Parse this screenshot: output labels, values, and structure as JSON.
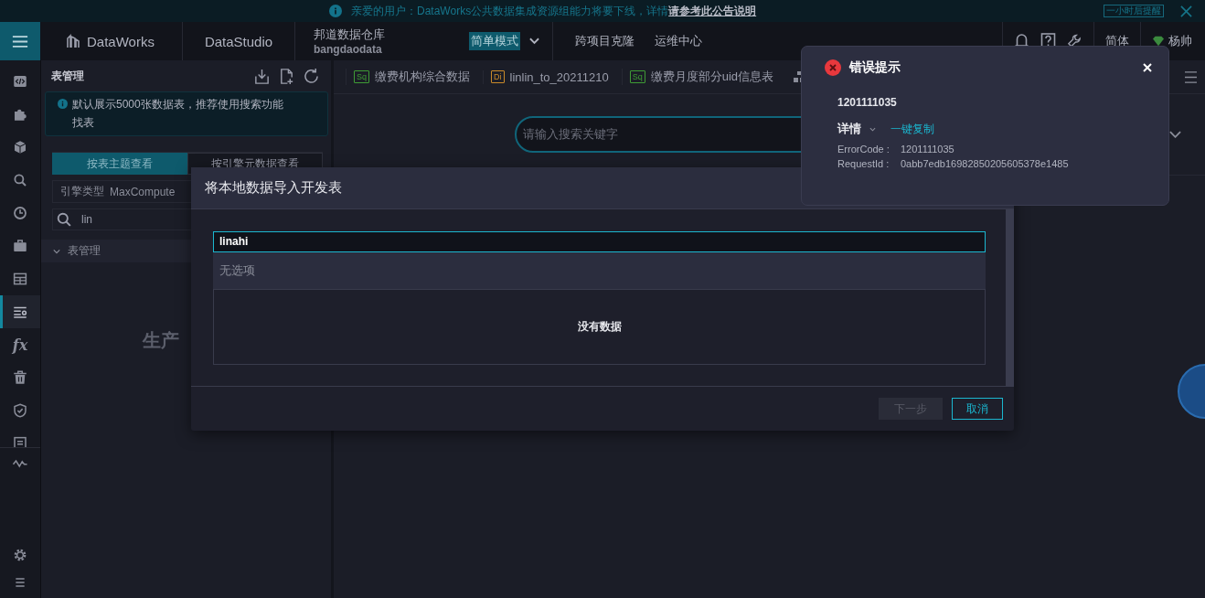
{
  "banner": {
    "message": "亲爱的用户：DataWorks公共数据集成资源组能力将要下线，详情",
    "link": "请参考此公告说明",
    "remind_button": "一小时后提醒"
  },
  "header": {
    "brand": "DataWorks",
    "module": "DataStudio",
    "workspace": {
      "name": "邦道数据仓库",
      "id": "bangdaodata"
    },
    "mode": "简单模式",
    "nav": [
      "跨项目克隆",
      "运维中心"
    ],
    "language": "简体",
    "user": "杨帅"
  },
  "rail": [
    {
      "selected": false
    },
    {
      "selected": false
    },
    {
      "selected": false
    },
    {
      "selected": false
    },
    {
      "selected": false
    },
    {
      "selected": false
    },
    {
      "selected": false
    },
    {
      "selected": true
    },
    {
      "selected": false,
      "glyph": "fx"
    },
    {
      "selected": false
    },
    {
      "selected": false
    },
    {
      "selected": false
    }
  ],
  "panel": {
    "title": "表管理",
    "notice": "默认展示5000张数据表，推荐使用搜索功能找表",
    "view_tabs": [
      {
        "label": "按表主题查看",
        "selected": true
      },
      {
        "label": "按引擎元数据查看",
        "selected": false
      }
    ],
    "engine": {
      "label": "引擎类型",
      "value": "MaxCompute"
    },
    "search": {
      "value": "lin"
    },
    "tree": [
      {
        "label": "表管理",
        "expanded": true
      }
    ],
    "background_text": "生产"
  },
  "editor_tabs": [
    {
      "label": "缴费机构综合数据",
      "type": "Sq",
      "color": "#3f9c35"
    },
    {
      "label": "linlin_to_20211210",
      "type": "Di",
      "color": "#c98a2a"
    },
    {
      "label": "缴费月度部分uid信息表",
      "type": "Sq",
      "color": "#3f9c35"
    }
  ],
  "search": {
    "placeholder": "请输入搜索关键字"
  },
  "dialog": {
    "title": "将本地数据导入开发表",
    "table_select": {
      "value": "linahi",
      "no_options": "无选项"
    },
    "empty": "没有数据",
    "buttons": [
      {
        "label": "下一步",
        "disabled": true
      },
      {
        "label": "取消",
        "disabled": false
      }
    ]
  },
  "toast": {
    "title": "错误提示",
    "message": "1201111035",
    "details_label": "详情",
    "copy_link": "一键复制",
    "fields": [
      {
        "label": "ErrorCode :",
        "value": "1201111035"
      },
      {
        "label": "RequestId :",
        "value": "0abb7edb16982850205605378e1485"
      }
    ]
  }
}
